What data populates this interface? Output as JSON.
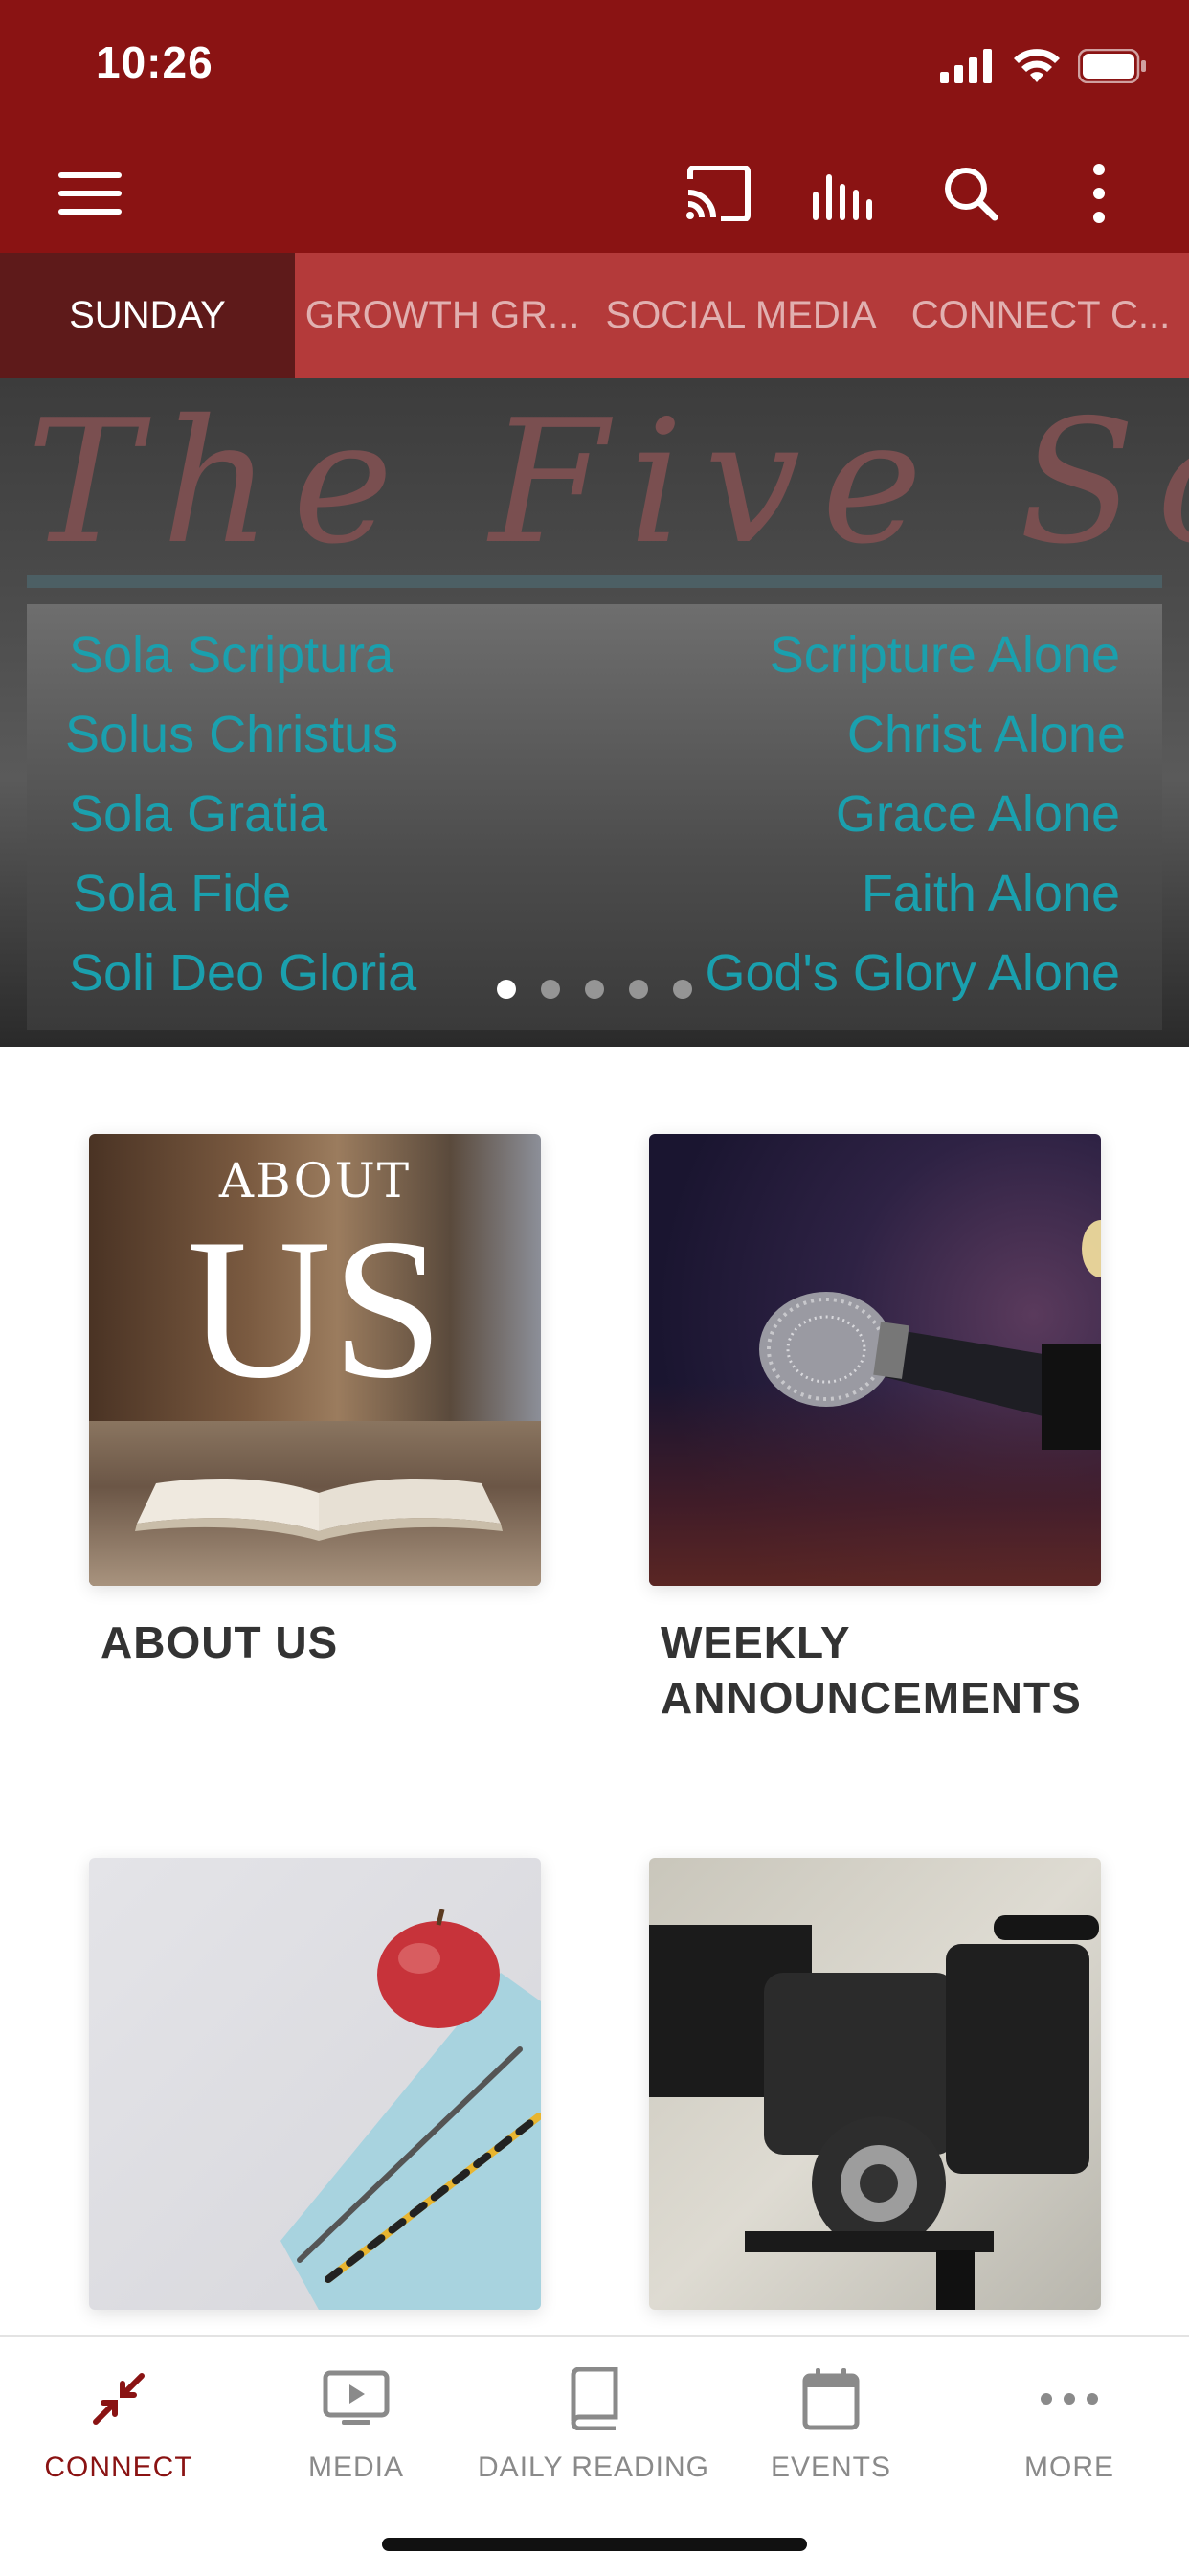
{
  "status_bar": {
    "time": "10:26"
  },
  "colors": {
    "brand": "#8a1313",
    "tab_strip": "#b43a3a",
    "tab_active": "#5e1a1a",
    "accent_text": "#1aa0ae"
  },
  "app_bar": {
    "icons": [
      "menu-icon",
      "cast-icon",
      "audio-bars-icon",
      "search-icon",
      "more-vertical-icon"
    ]
  },
  "category_tabs": [
    {
      "label": "SUNDAY",
      "active": true
    },
    {
      "label": "GROWTH GR...",
      "active": false
    },
    {
      "label": "SOCIAL MEDIA",
      "active": false
    },
    {
      "label": "CONNECT C...",
      "active": false
    }
  ],
  "hero": {
    "title": "The Five Solas",
    "rows": [
      {
        "left": "Sola Scriptura",
        "right": "Scripture Alone"
      },
      {
        "left": "Solus Christus",
        "right": "Christ Alone"
      },
      {
        "left": "Sola Gratia",
        "right": "Grace Alone"
      },
      {
        "left": "Sola Fide",
        "right": "Faith Alone"
      },
      {
        "left": "Soli Deo Gloria",
        "right": "God's Glory Alone"
      }
    ],
    "carousel_pages": 5,
    "carousel_active": 1
  },
  "cards": [
    {
      "title": "ABOUT US",
      "image_text_small": "ABOUT",
      "image_text_big": "US"
    },
    {
      "title": "WEEKLY ANNOUNCEMENTS"
    },
    {
      "title": ""
    },
    {
      "title": ""
    }
  ],
  "tab_bar": [
    {
      "label": "CONNECT",
      "icon": "connect-arrows-icon",
      "active": true
    },
    {
      "label": "MEDIA",
      "icon": "media-play-icon",
      "active": false
    },
    {
      "label": "DAILY READING",
      "icon": "book-icon",
      "active": false
    },
    {
      "label": "EVENTS",
      "icon": "calendar-icon",
      "active": false
    },
    {
      "label": "MORE",
      "icon": "more-horizontal-icon",
      "active": false
    }
  ]
}
